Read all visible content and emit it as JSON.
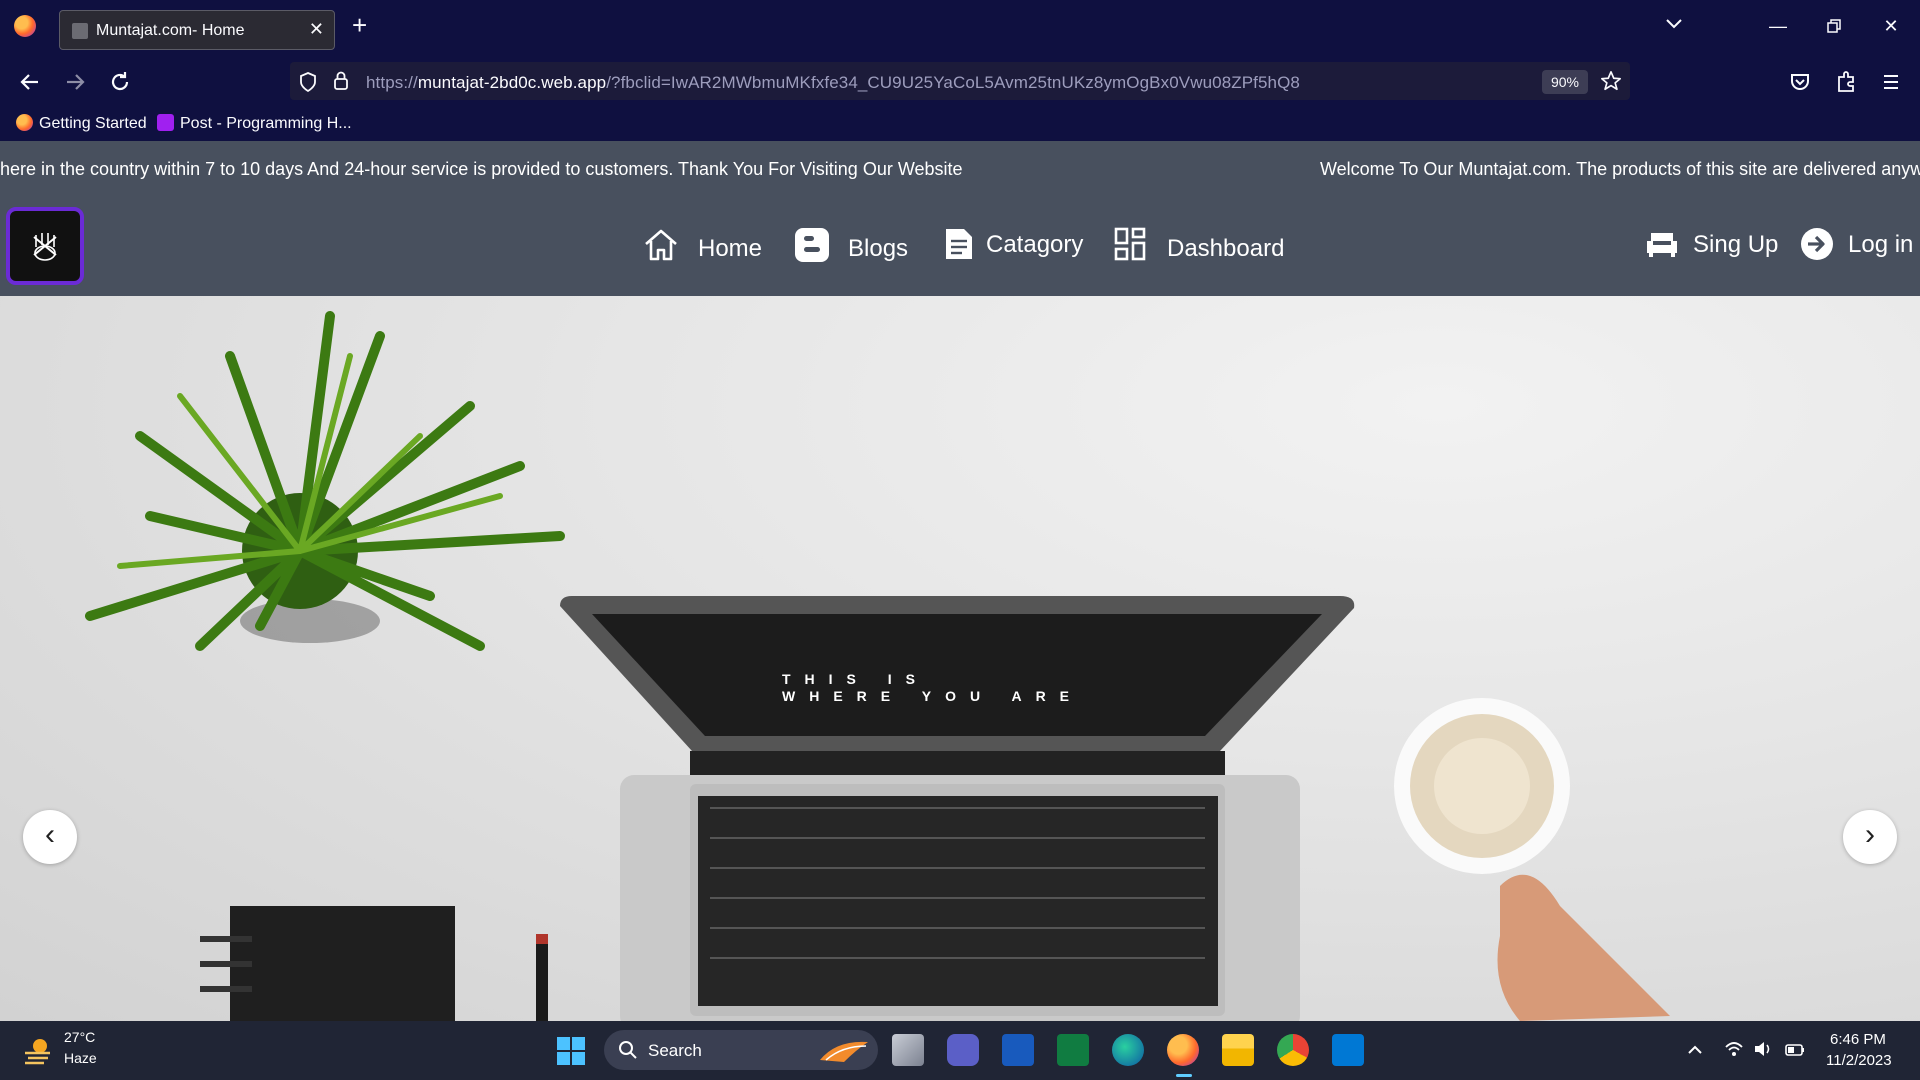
{
  "browser": {
    "tab": {
      "title": "Muntajat.com- Home"
    },
    "url": {
      "scheme": "https://",
      "host": "muntajat-2bd0c.web.app",
      "rest": "/?fbclid=IwAR2MWbmuMKfxfe34_CU9U25YaCoL5Avm25tnUKz8ymOgBx0Vwu08ZPf5hQ8"
    },
    "zoom": "90%",
    "bookmarks": [
      "Getting Started",
      "Post - Programming H..."
    ]
  },
  "site": {
    "marquee": {
      "segment_a": "here in the country within 7 to 10 days And 24-hour service is provided to customers. Thank You For Visiting Our Website",
      "segment_b": "Welcome To Our Muntajat.com. The products of this site are delivered anyw"
    },
    "nav": {
      "home": "Home",
      "blogs": "Blogs",
      "category": "Catagory",
      "dashboard": "Dashboard",
      "signup": "Sing Up",
      "login": "Log in"
    },
    "hero": {
      "screen_line1": "THIS IS",
      "screen_line2": "WHERE YOU ARE",
      "prev": "‹",
      "next": "›"
    }
  },
  "taskbar": {
    "weather": {
      "temp": "27°C",
      "condition": "Haze"
    },
    "search": "Search",
    "time": "6:46 PM",
    "date": "11/2/2023"
  },
  "colors": {
    "chrome": "#0f1040",
    "site_nav": "#48505e",
    "logo_border": "#6b2bd6",
    "taskbar": "#202535"
  }
}
